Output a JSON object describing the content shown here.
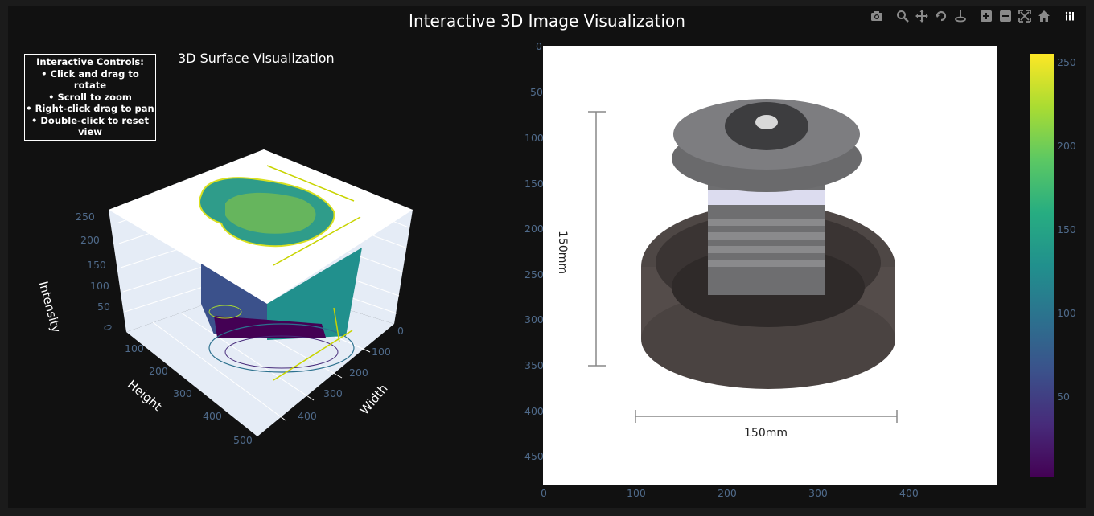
{
  "title": "Interactive 3D Image Visualization",
  "modebar": [
    {
      "name": "camera-icon"
    },
    {
      "name": "zoom-icon"
    },
    {
      "name": "pan-icon"
    },
    {
      "name": "orbit-rotation-icon"
    },
    {
      "name": "turntable-rotation-icon"
    },
    {
      "name": "zoom-in-icon"
    },
    {
      "name": "zoom-out-icon"
    },
    {
      "name": "autoscale-icon"
    },
    {
      "name": "home-icon"
    },
    {
      "name": "plotly-logo-icon"
    }
  ],
  "controls": {
    "heading": "Interactive Controls:",
    "line1": "• Click and drag to rotate",
    "line2": "• Scroll to zoom",
    "line3": "• Right-click drag to pan",
    "line4": "• Double-click to reset view"
  },
  "surface": {
    "subtitle": "3D Surface Visualization",
    "z_label": "Intensity",
    "x_label": "Height",
    "y_label": "Width",
    "z_ticks": [
      "0",
      "50",
      "100",
      "150",
      "200",
      "250"
    ],
    "x_ticks": [
      "100",
      "200",
      "300",
      "400",
      "500"
    ],
    "y_ticks": [
      "0",
      "100",
      "200",
      "300",
      "400"
    ]
  },
  "image_panel": {
    "dim_vertical": "150mm",
    "dim_horizontal": "150mm",
    "y_ticks": [
      "0",
      "50",
      "100",
      "150",
      "200",
      "250",
      "300",
      "350",
      "400",
      "450"
    ],
    "x_ticks": [
      "0",
      "100",
      "200",
      "300",
      "400"
    ]
  },
  "colorbar": {
    "ticks": [
      "250",
      "200",
      "150",
      "100",
      "50"
    ],
    "colorscale": [
      "#440154",
      "#3b518b",
      "#21908d",
      "#5cc863",
      "#fde725"
    ]
  }
}
